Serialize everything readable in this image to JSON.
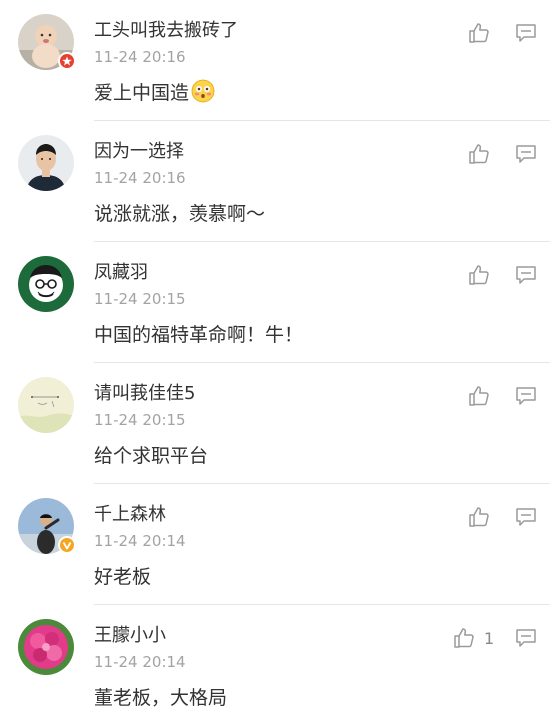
{
  "comments": [
    {
      "username": "工头叫我去搬砖了",
      "time": "11-24 20:16",
      "text": "爱上中国造",
      "emoji": "flushed-face",
      "like_count": "",
      "badge": "red-star-badge"
    },
    {
      "username": "因为一选择",
      "time": "11-24 20:16",
      "text": "说涨就涨，羡慕啊～",
      "like_count": ""
    },
    {
      "username": "凤藏羽",
      "time": "11-24 20:15",
      "text": "中国的福特革命啊！牛！",
      "like_count": ""
    },
    {
      "username": "请叫莪佳佳5",
      "time": "11-24 20:15",
      "text": "给个求职平台",
      "like_count": ""
    },
    {
      "username": "千上森林",
      "time": "11-24 20:14",
      "text": "好老板",
      "like_count": "",
      "badge": "verified-v-badge"
    },
    {
      "username": "王朦小小",
      "time": "11-24 20:14",
      "text": "董老板，大格局",
      "like_count": "1"
    }
  ],
  "colors": {
    "text": "#333333",
    "time": "#a3a3a3",
    "icon": "#9a9a9a",
    "divider": "#e6e6e6",
    "badge_red": "#e6402f",
    "badge_gold": "#f5a623"
  },
  "icons": {
    "like": "thumbs-up-icon",
    "reply": "comment-icon"
  }
}
